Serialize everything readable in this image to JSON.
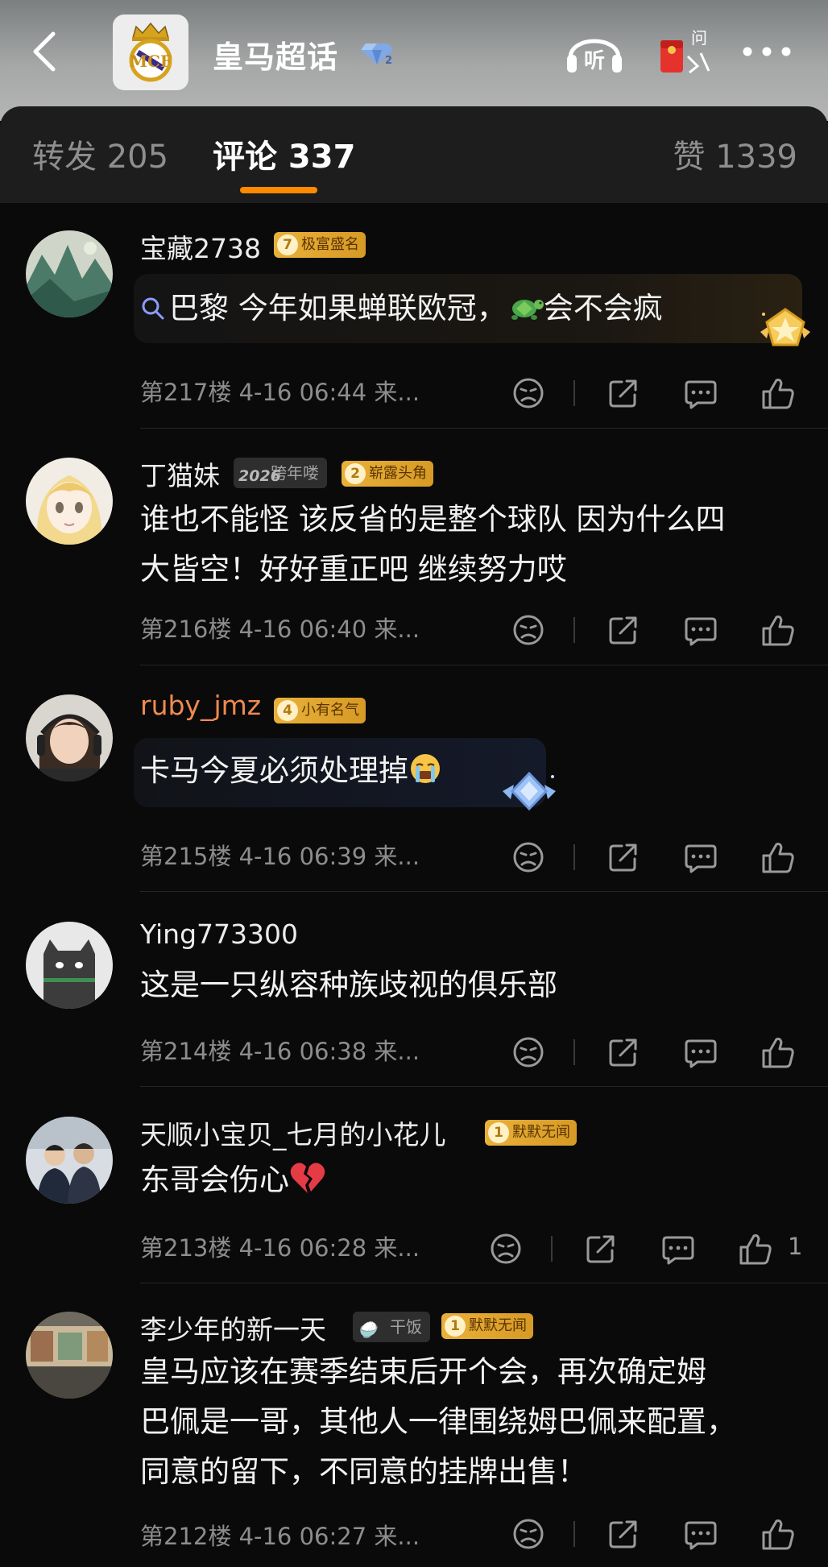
{
  "header": {
    "title": "皇马超话"
  },
  "tabs": {
    "forward": "转发 205",
    "comment": "评论 337",
    "like": "赞 1339"
  },
  "comments": [
    {
      "user": "宝藏2738",
      "badges": [
        {
          "num": "7",
          "label": "极富盛名"
        }
      ],
      "text": "巴黎 今年如果蝉联欧冠，",
      "text_tail": "会不会疯",
      "meta": "第217楼  4-16 06:44  来...",
      "likes": ""
    },
    {
      "user": "丁猫妹",
      "grey_badge": {
        "icon": "2026",
        "label": "跨年喽"
      },
      "badges": [
        {
          "num": "2",
          "label": "崭露头角"
        }
      ],
      "text_line1": "谁也不能怪 该反省的是整个球队 因为什么四",
      "text_line2": "大皆空！好好重正吧 继续努力哎",
      "meta": "第216楼  4-16 06:40  来...",
      "likes": ""
    },
    {
      "user": "ruby_jmz",
      "badges": [
        {
          "num": "4",
          "label": "小有名气"
        }
      ],
      "text": "卡马今夏必须处理掉",
      "meta": "第215楼  4-16 06:39  来...",
      "likes": ""
    },
    {
      "user": "Ying773300",
      "text": "这是一只纵容种族歧视的俱乐部",
      "meta": "第214楼  4-16 06:38  来...",
      "likes": ""
    },
    {
      "user": "天顺小宝贝_七月的小花儿",
      "badges": [
        {
          "num": "1",
          "label": "默默无闻"
        }
      ],
      "text": "东哥会伤心",
      "meta": "第213楼  4-16 06:28  来...",
      "likes": "1"
    },
    {
      "user": "李少年的新一天",
      "grey_badge": {
        "icon": "🍚",
        "label": "干饭"
      },
      "badges": [
        {
          "num": "1",
          "label": "默默无闻"
        }
      ],
      "text_line1": "皇马应该在赛季结束后开个会，再次确定姆",
      "text_line2": "巴佩是一哥，其他人一律围绕姆巴佩来配置，",
      "text_line3": "同意的留下，不同意的挂牌出售！",
      "meta": "第212楼  4-16 06:27  来...",
      "likes": ""
    }
  ],
  "colors": {
    "accent": "#ff8a00",
    "badge_gold": "#e9b13a",
    "username_orange": "#f08a4f"
  }
}
